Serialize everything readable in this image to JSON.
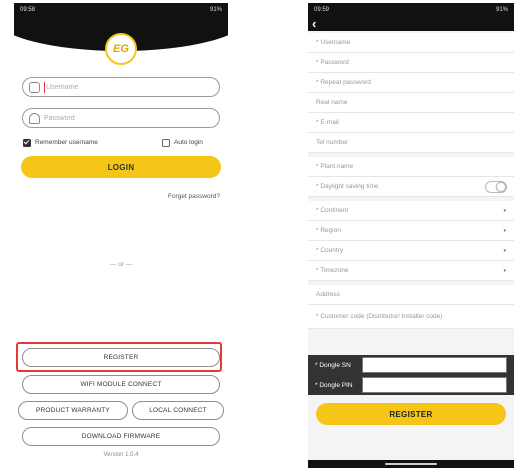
{
  "left": {
    "status": {
      "time": "09:58",
      "right": "91%"
    },
    "logo_text": "EG",
    "username_placeholder": "Username",
    "password_placeholder": "Password",
    "remember_label": "Remember username",
    "auto_login_label": "Auto login",
    "login_label": "LOGIN",
    "forgot_label": "Forget password?",
    "or_label": "— or —",
    "register_label": "REGISTER",
    "wifi_label": "WIFI MODULE CONNECT",
    "warranty_label": "PRODUCT WARRANTY",
    "local_label": "LOCAL CONNECT",
    "firmware_label": "DOWNLOAD FIRMWARE",
    "version": "Version 1.0.4",
    "accent_color": "#f5c518",
    "highlight_color": "#e53935"
  },
  "right": {
    "status": {
      "time": "09:59",
      "right": "91%"
    },
    "back_icon": "chevron-left",
    "fields": {
      "username": "* Username",
      "password": "* Password",
      "repeat_password": "* Repeat password",
      "real_name": "Real name",
      "email": "* E-mail",
      "tel": "Tel number",
      "plant_name": "* Plant name",
      "dst": "* Daylight saving time",
      "continent": "* Continent",
      "region": "* Region",
      "country": "* Country",
      "timezone": "* Timezone",
      "address": "Address",
      "customer_code": "* Customer code (Distributor/ Installer code)"
    },
    "dongle_sn_label": "* Dongle SN",
    "dongle_pin_label": "* Dongle PIN",
    "register_label": "REGISTER",
    "dropdown_icon": "▾"
  }
}
